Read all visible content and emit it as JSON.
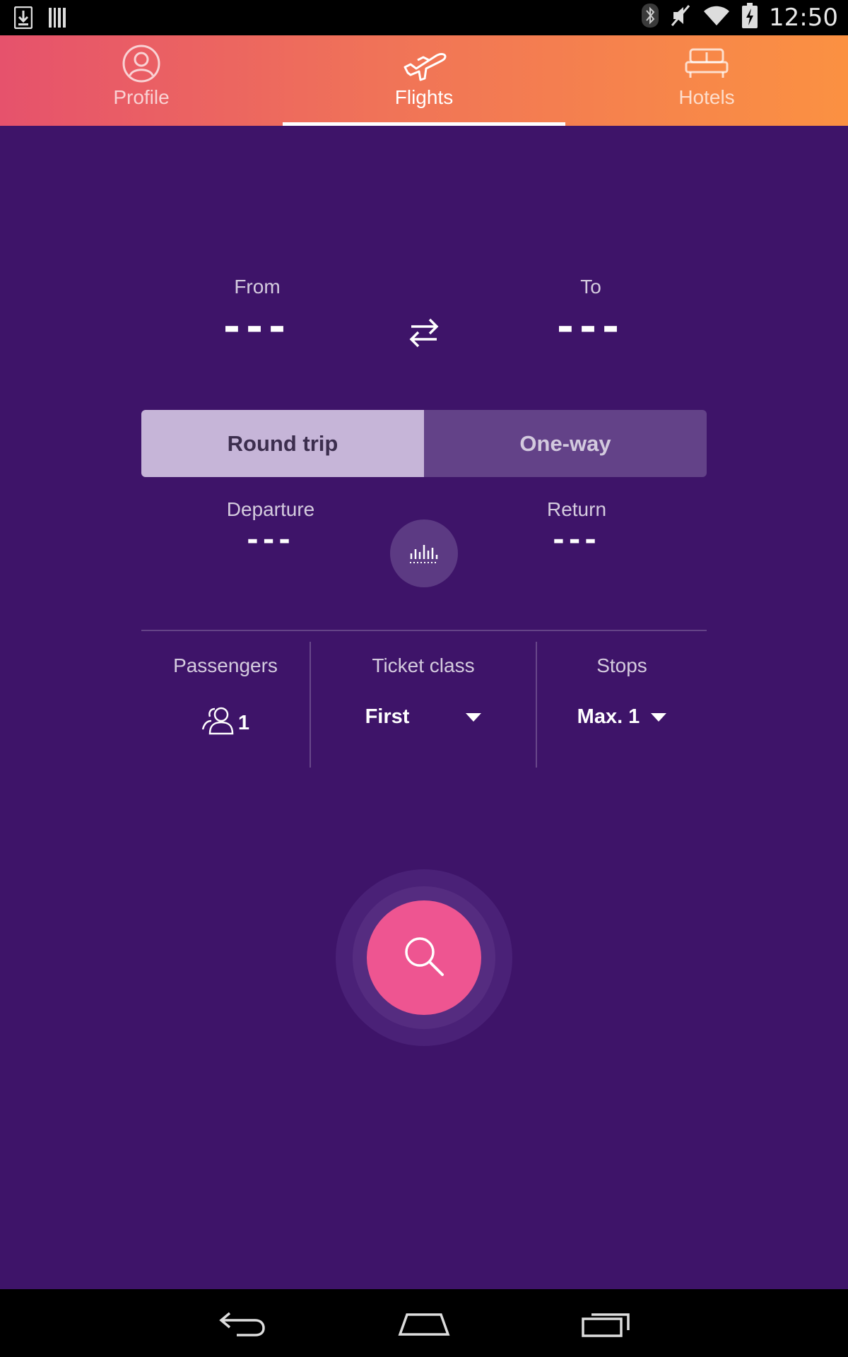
{
  "status_bar": {
    "time": "12:50",
    "icons": [
      "download-icon",
      "barcode-icon",
      "bluetooth-icon",
      "mute-icon",
      "wifi-icon",
      "battery-charging-icon"
    ]
  },
  "tabs": [
    {
      "label": "Profile",
      "icon": "profile-icon",
      "active": false
    },
    {
      "label": "Flights",
      "icon": "airplane-icon",
      "active": true
    },
    {
      "label": "Hotels",
      "icon": "bed-icon",
      "active": false
    }
  ],
  "route": {
    "from_label": "From",
    "from_value": "---",
    "to_label": "To",
    "to_value": "---",
    "swap_icon": "swap-arrows-icon"
  },
  "trip_type": {
    "round_trip": "Round trip",
    "one_way": "One-way",
    "selected": "Round trip"
  },
  "dates": {
    "departure_label": "Departure",
    "departure_value": "---",
    "return_label": "Return",
    "return_value": "---",
    "calendar_icon": "price-calendar-icon"
  },
  "options": {
    "passengers_label": "Passengers",
    "passengers_value": "1",
    "ticket_class_label": "Ticket class",
    "ticket_class_value": "First",
    "stops_label": "Stops",
    "stops_value": "Max. 1"
  },
  "search": {
    "icon": "search-icon"
  },
  "colors": {
    "background": "#3e1469",
    "tab_gradient_start": "#e6526c",
    "tab_gradient_end": "#fb9142",
    "search_button": "#ee5591",
    "round_trip_selected": "#c6b5d8",
    "one_way_unselected": "#634288"
  },
  "nav_bar": [
    "back-icon",
    "home-icon",
    "recents-icon"
  ]
}
